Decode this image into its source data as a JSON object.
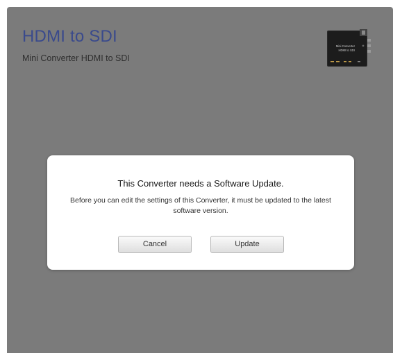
{
  "header": {
    "title": "HDMI to SDI",
    "subtitle": "Mini Converter HDMI to SDI"
  },
  "device_image": {
    "icon": "mini-converter-device-icon",
    "label_line1": "Mini Converter",
    "label_line2": "HDMI to SDI"
  },
  "dialog": {
    "title": "This Converter needs a Software Update.",
    "message": "Before you can edit the settings of this Converter, it must be updated to the latest software version.",
    "cancel_label": "Cancel",
    "update_label": "Update"
  },
  "colors": {
    "background": "#7b7b7b",
    "title": "#3a4a8c",
    "dialog": "#ffffff"
  }
}
